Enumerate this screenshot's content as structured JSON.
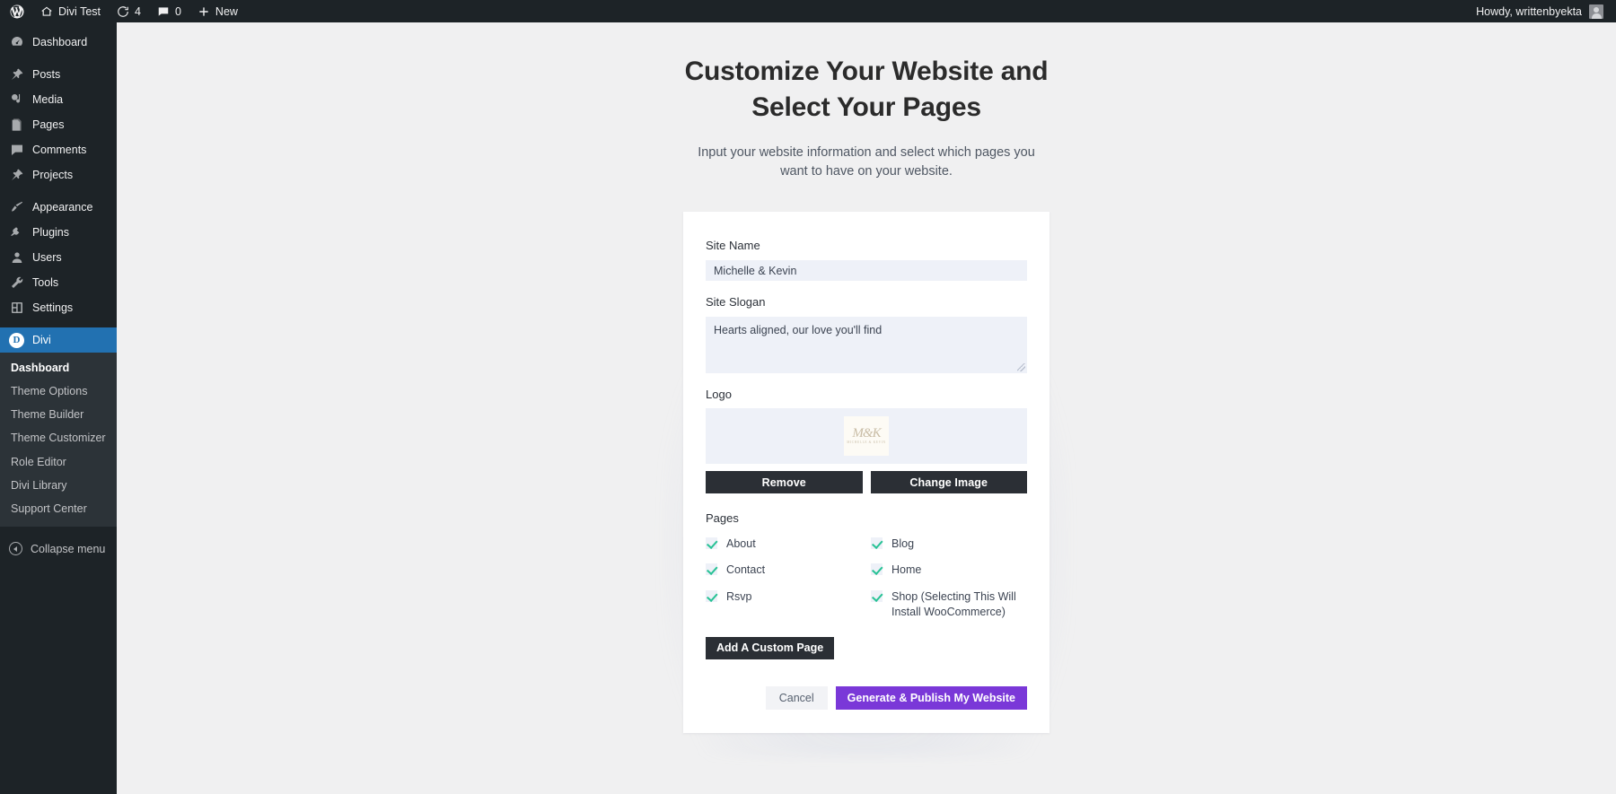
{
  "adminbar": {
    "wp_logo": "wordpress-logo-icon",
    "site_name": "Divi Test",
    "updates_icon": "updates-icon",
    "updates_count": "4",
    "comments_icon": "comments-bubble-icon",
    "comments_count": "0",
    "new_icon": "plus-icon",
    "new_label": "New",
    "howdy": "Howdy, writtenbyekta"
  },
  "sidebar": {
    "items": [
      {
        "label": "Dashboard",
        "icon": "dashboard-icon"
      },
      {
        "label": "Posts",
        "icon": "pin-icon"
      },
      {
        "label": "Media",
        "icon": "media-icon"
      },
      {
        "label": "Pages",
        "icon": "pages-icon"
      },
      {
        "label": "Comments",
        "icon": "comments-icon"
      },
      {
        "label": "Projects",
        "icon": "pin-icon"
      },
      {
        "label": "Appearance",
        "icon": "appearance-brush-icon"
      },
      {
        "label": "Plugins",
        "icon": "plugin-plug-icon"
      },
      {
        "label": "Users",
        "icon": "user-icon"
      },
      {
        "label": "Tools",
        "icon": "wrench-icon"
      },
      {
        "label": "Settings",
        "icon": "settings-sliders-icon"
      },
      {
        "label": "Divi",
        "icon": "divi-d-icon",
        "active": true
      }
    ],
    "submenu": [
      {
        "label": "Dashboard",
        "current": true
      },
      {
        "label": "Theme Options"
      },
      {
        "label": "Theme Builder"
      },
      {
        "label": "Theme Customizer"
      },
      {
        "label": "Role Editor"
      },
      {
        "label": "Divi Library"
      },
      {
        "label": "Support Center"
      }
    ],
    "collapse_label": "Collapse menu",
    "collapse_icon": "collapse-arrow-icon",
    "active_color": "#2271b1"
  },
  "wizard": {
    "title": "Customize Your Website and Select Your Pages",
    "subtitle": "Input your website information and select which pages you want to have on your website.",
    "site_name": {
      "label": "Site Name",
      "value": "Michelle & Kevin",
      "placeholder": "Site Name"
    },
    "site_slogan": {
      "label": "Site Slogan",
      "value": "Hearts aligned, our love you'll find",
      "placeholder": "Site Slogan"
    },
    "logo": {
      "label": "Logo",
      "thumbnail_alt": "M K monogram logo",
      "monogram": "M K",
      "monogram_sub": "MICHELLE & KEVIN",
      "remove_label": "Remove",
      "change_label": "Change Image"
    },
    "pages": {
      "label": "Pages",
      "items": [
        {
          "label": "About",
          "checked": true
        },
        {
          "label": "Blog",
          "checked": true
        },
        {
          "label": "Contact",
          "checked": true
        },
        {
          "label": "Home",
          "checked": true
        },
        {
          "label": "Rsvp",
          "checked": true
        },
        {
          "label": "Shop (Selecting This Will Install WooCommerce)",
          "checked": true
        }
      ],
      "add_custom_label": "Add A Custom Page"
    },
    "footer": {
      "cancel_label": "Cancel",
      "submit_label": "Generate & Publish My Website",
      "submit_color": "#7a38d8"
    },
    "checkmark_color": "#27c295"
  }
}
